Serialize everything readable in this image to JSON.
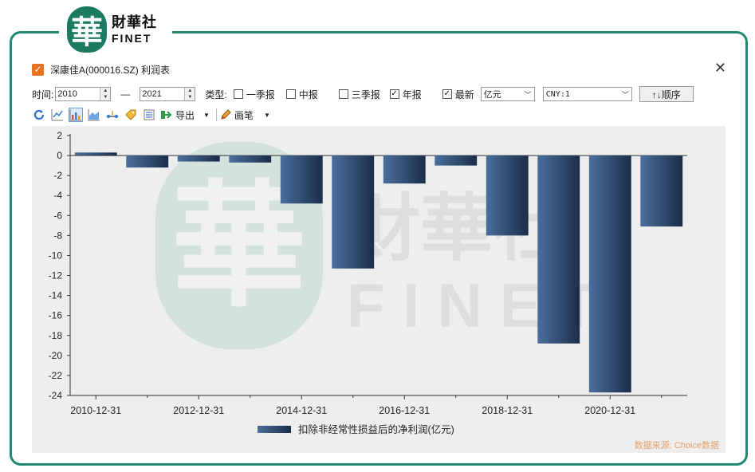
{
  "brand": {
    "cn": "財華社",
    "en": "FINET",
    "seal_char": "華"
  },
  "window": {
    "title": "深康佳A(000016.SZ) 利润表"
  },
  "filters": {
    "time_label": "时间:",
    "start_year": "2010",
    "dash": "—",
    "end_year": "2021",
    "type_label": "类型:",
    "q1": "一季报",
    "mid": "中报",
    "q3": "三季报",
    "annual": "年报",
    "latest": "最新",
    "unit": "亿元",
    "currency": "CNY:1",
    "order_button": "↑↓顺序"
  },
  "checks": {
    "q1": false,
    "mid": false,
    "q3": false,
    "annual": true,
    "latest": true
  },
  "toolbar": {
    "export_label": "导出",
    "draw_label": "画笔"
  },
  "source": "数据来源: Choice数据",
  "colors": {
    "bar_dark": "#1b2d49",
    "bar_light": "#4a6f9d",
    "frame": "#1f8a70",
    "accent": "#e8731e"
  },
  "chart_data": {
    "type": "bar",
    "x": [
      2010,
      2011,
      2012,
      2013,
      2014,
      2015,
      2016,
      2017,
      2018,
      2019,
      2020,
      2021
    ],
    "values": [
      0.3,
      -1.2,
      -0.6,
      -0.7,
      -4.8,
      -11.3,
      -2.8,
      -1.0,
      -8.0,
      -18.8,
      -23.7,
      -7.1
    ],
    "series_name": "扣除非经常性损益后的净利润(亿元)",
    "ylim": [
      -24,
      2
    ],
    "yticks": [
      2,
      0,
      -2,
      -4,
      -6,
      -8,
      -10,
      -12,
      -14,
      -16,
      -18,
      -20,
      -22,
      -24
    ],
    "xtick_labels": [
      "2010-12-31",
      "2012-12-31",
      "2014-12-31",
      "2016-12-31",
      "2018-12-31",
      "2020-12-31"
    ],
    "grid": false,
    "legend": "bottom-center"
  }
}
